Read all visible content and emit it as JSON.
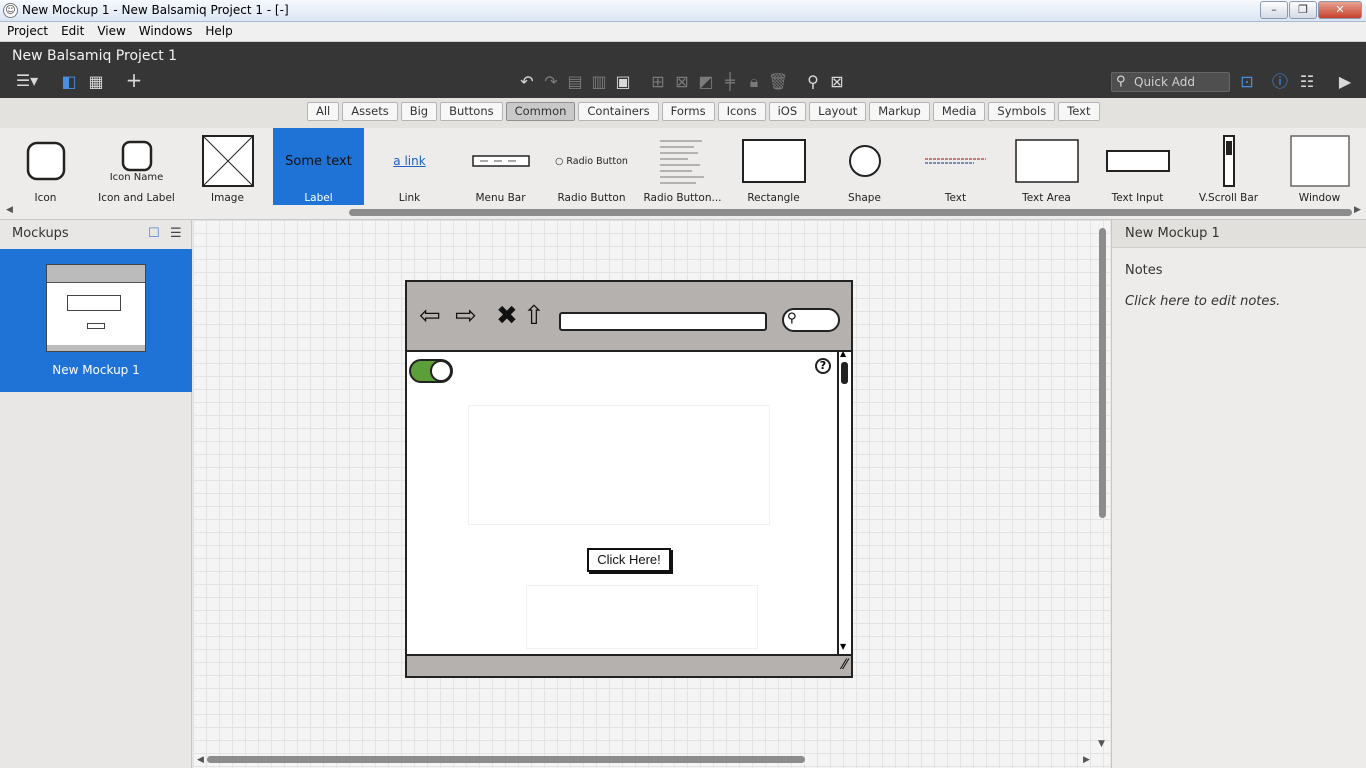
{
  "window": {
    "title": "New Mockup 1 - New Balsamiq Project 1 - [-]",
    "controls": {
      "minimize": "–",
      "maximize": "❐",
      "close": "✕"
    }
  },
  "menubar": [
    "Project",
    "Edit",
    "View",
    "Windows",
    "Help"
  ],
  "project": {
    "title": "New Balsamiq Project 1"
  },
  "toolbar": {
    "quick_add_placeholder": "Quick Add"
  },
  "filter_tabs": {
    "items": [
      "All",
      "Assets",
      "Big",
      "Buttons",
      "Common",
      "Containers",
      "Forms",
      "Icons",
      "iOS",
      "Layout",
      "Markup",
      "Media",
      "Symbols",
      "Text"
    ],
    "active": "Common"
  },
  "palette": {
    "selected": "Label",
    "items": [
      {
        "label": "Icon"
      },
      {
        "label": "Icon and Label",
        "preview_text": "Icon Name"
      },
      {
        "label": "Image"
      },
      {
        "label": "Label",
        "preview_text": "Some text"
      },
      {
        "label": "Link",
        "preview_text": "a link"
      },
      {
        "label": "Menu Bar"
      },
      {
        "label": "Radio Button",
        "preview_text": "Radio Button"
      },
      {
        "label": "Radio Button..."
      },
      {
        "label": "Rectangle"
      },
      {
        "label": "Shape"
      },
      {
        "label": "Text"
      },
      {
        "label": "Text Area"
      },
      {
        "label": "Text Input"
      },
      {
        "label": "V.Scroll Bar"
      },
      {
        "label": "Window"
      }
    ]
  },
  "mockups_panel": {
    "title": "Mockups",
    "items": [
      {
        "label": "New Mockup 1",
        "selected": true
      }
    ]
  },
  "canvas": {
    "wireframe": {
      "button_label": "Click Here!",
      "help_glyph": "?"
    }
  },
  "right_panel": {
    "title": "New Mockup 1",
    "notes_label": "Notes",
    "notes_hint": "Click here to edit notes."
  },
  "colors": {
    "accent_selected": "#1f73d6",
    "header_bg": "#363636",
    "toggle_green": "#5c9e3a"
  }
}
